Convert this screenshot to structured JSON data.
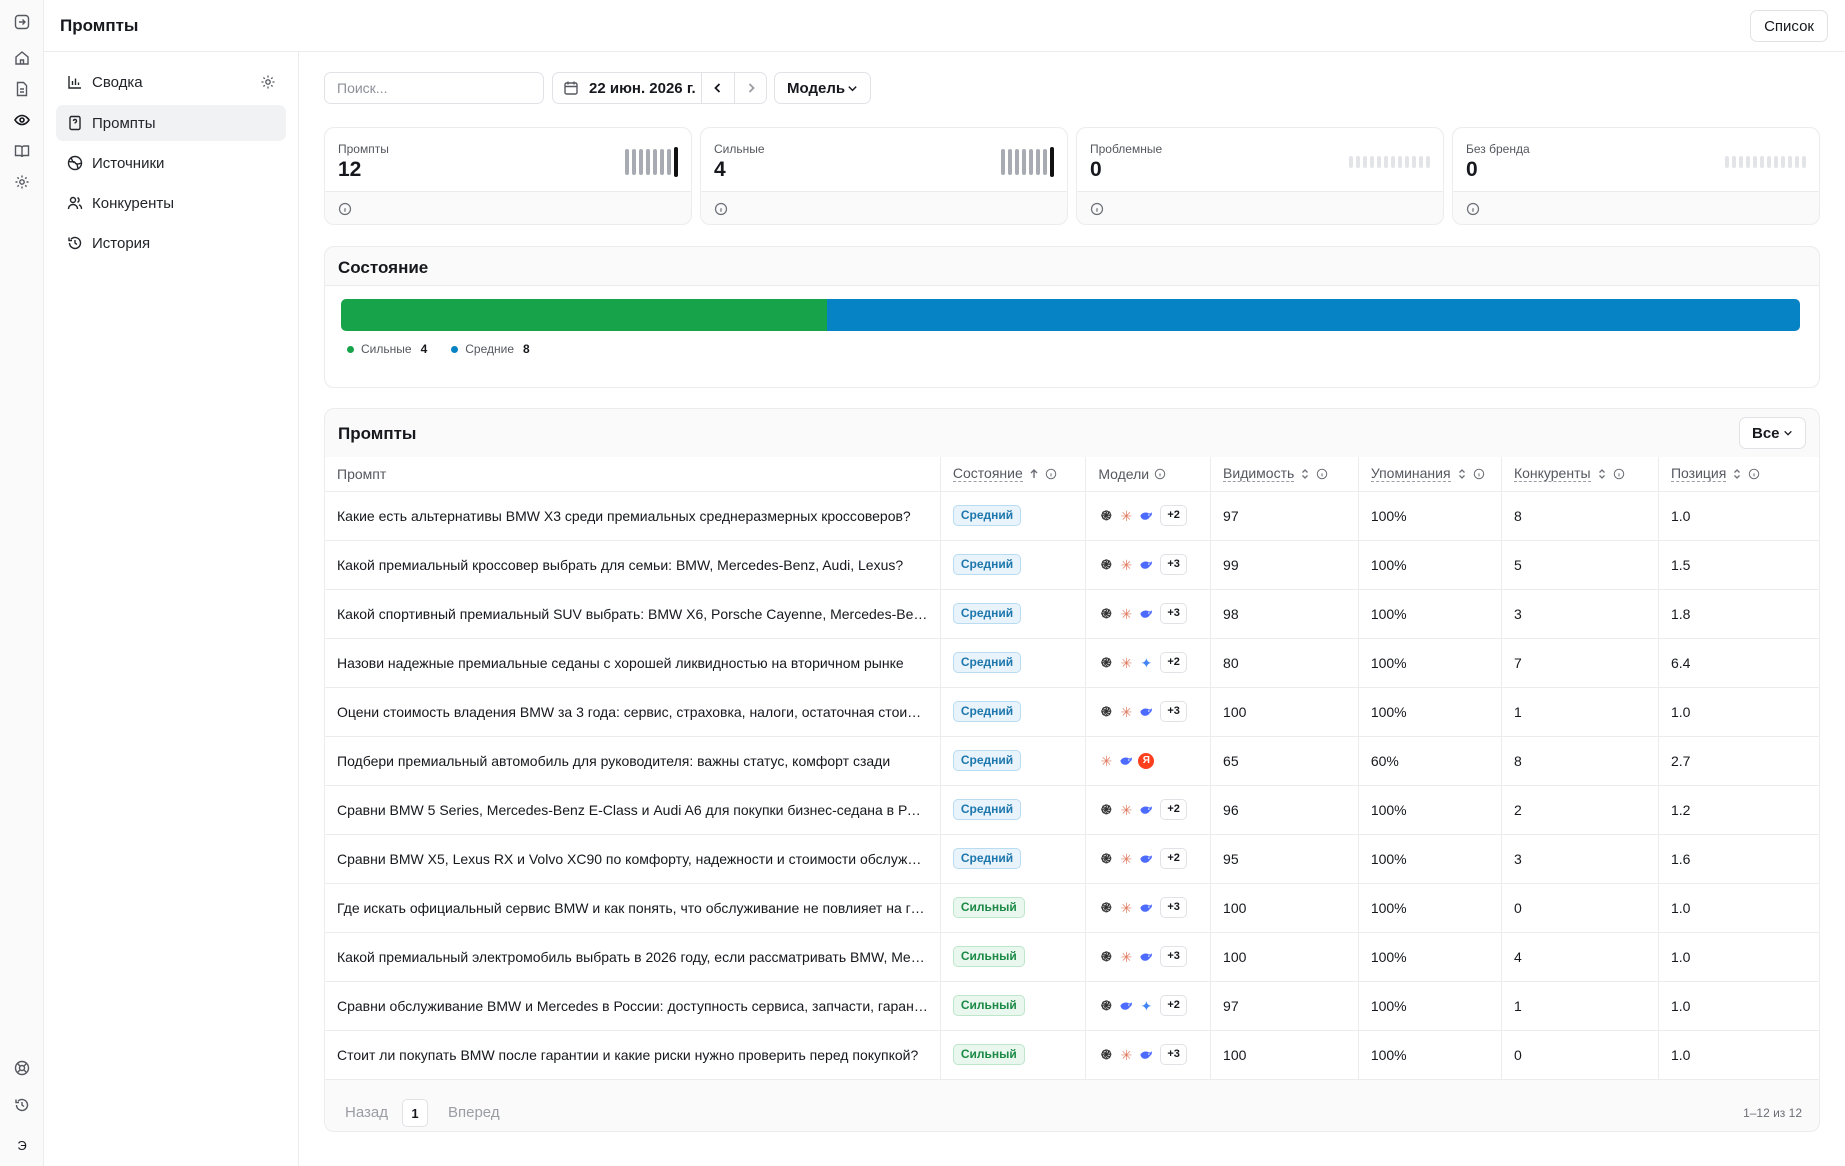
{
  "page": {
    "title": "Промпты",
    "list_button": "Список"
  },
  "rail": {
    "icons": [
      "sidebar-toggle-icon",
      "home-icon",
      "document-icon",
      "eye-icon",
      "book-icon",
      "gear-icon",
      "help-icon",
      "history-icon",
      "logo-icon"
    ],
    "logo_text": "Э"
  },
  "sidebar": {
    "items": [
      {
        "label": "Сводка",
        "icon": "bar-chart-icon",
        "active": false
      },
      {
        "label": "Промпты",
        "icon": "prompt-doc-icon",
        "active": true
      },
      {
        "label": "Источники",
        "icon": "globe-icon",
        "active": false
      },
      {
        "label": "Конкуренты",
        "icon": "users-icon",
        "active": false
      },
      {
        "label": "История",
        "icon": "history-icon",
        "active": false
      }
    ]
  },
  "filters": {
    "search_placeholder": "Поиск...",
    "date": "22 июн. 2026 г.",
    "model_label": "Модель"
  },
  "stats": [
    {
      "label": "Промпты",
      "value": "12",
      "bars": 8,
      "active_bars": 8
    },
    {
      "label": "Сильные",
      "value": "4",
      "bars": 8,
      "active_bars": 8
    },
    {
      "label": "Проблемные",
      "value": "0",
      "bars": 12,
      "active_bars": 0
    },
    {
      "label": "Без бренда",
      "value": "0",
      "bars": 12,
      "active_bars": 0
    }
  ],
  "state": {
    "title": "Состояние",
    "segments": [
      {
        "label": "Сильные",
        "count": "4",
        "value": 4,
        "color": "#16a34a"
      },
      {
        "label": "Средние",
        "count": "8",
        "value": 8,
        "color": "#0683c5"
      }
    ]
  },
  "prompts_table": {
    "title": "Промпты",
    "filter_label": "Все",
    "columns": [
      "Промпт",
      "Состояние",
      "Модели",
      "Видимость",
      "Упоминания",
      "Конкуренты",
      "Позиция"
    ],
    "rows": [
      {
        "prompt": "Какие есть альтернативы BMW X3 среди премиальных среднеразмерных кроссоверов?",
        "state": "Средний",
        "models": [
          "gpt",
          "claude",
          "deepseek"
        ],
        "more": "+2",
        "visibility": "97",
        "mentions": "100%",
        "competitors": "8",
        "position": "1.0"
      },
      {
        "prompt": "Какой премиальный кроссовер выбрать для семьи: BMW, Mercedes-Benz, Audi, Lexus?",
        "state": "Средний",
        "models": [
          "gpt",
          "claude",
          "deepseek"
        ],
        "more": "+3",
        "visibility": "99",
        "mentions": "100%",
        "competitors": "5",
        "position": "1.5"
      },
      {
        "prompt": "Какой спортивный премиальный SUV выбрать: BMW X6, Porsche Cayenne, Mercedes-Benz GLE?",
        "state": "Средний",
        "models": [
          "gpt",
          "claude",
          "deepseek"
        ],
        "more": "+3",
        "visibility": "98",
        "mentions": "100%",
        "competitors": "3",
        "position": "1.8"
      },
      {
        "prompt": "Назови надежные премиальные седаны с хорошей ликвидностью на вторичном рынке",
        "state": "Средний",
        "models": [
          "gpt",
          "claude",
          "gemini"
        ],
        "more": "+2",
        "visibility": "80",
        "mentions": "100%",
        "competitors": "7",
        "position": "6.4"
      },
      {
        "prompt": "Оцени стоимость владения BMW за 3 года: сервис, страховка, налоги, остаточная стоимость",
        "state": "Средний",
        "models": [
          "gpt",
          "claude",
          "deepseek"
        ],
        "more": "+3",
        "visibility": "100",
        "mentions": "100%",
        "competitors": "1",
        "position": "1.0"
      },
      {
        "prompt": "Подбери премиальный автомобиль для руководителя: важны статус, комфорт сзади",
        "state": "Средний",
        "models": [
          "claude",
          "deepseek",
          "yandex"
        ],
        "more": "",
        "visibility": "65",
        "mentions": "60%",
        "competitors": "8",
        "position": "2.7"
      },
      {
        "prompt": "Сравни BMW 5 Series, Mercedes-Benz E-Class и Audi A6 для покупки бизнес-седана в России",
        "state": "Средний",
        "models": [
          "gpt",
          "claude",
          "deepseek"
        ],
        "more": "+2",
        "visibility": "96",
        "mentions": "100%",
        "competitors": "2",
        "position": "1.2"
      },
      {
        "prompt": "Сравни BMW X5, Lexus RX и Volvo XC90 по комфорту, надежности и стоимости обслуживания",
        "state": "Средний",
        "models": [
          "gpt",
          "claude",
          "deepseek"
        ],
        "more": "+2",
        "visibility": "95",
        "mentions": "100%",
        "competitors": "3",
        "position": "1.6"
      },
      {
        "prompt": "Где искать официальный сервис BMW и как понять, что обслуживание не повлияет на гарантию?",
        "state": "Сильный",
        "models": [
          "gpt",
          "claude",
          "deepseek"
        ],
        "more": "+3",
        "visibility": "100",
        "mentions": "100%",
        "competitors": "0",
        "position": "1.0"
      },
      {
        "prompt": "Какой премиальный электромобиль выбрать в 2026 году, если рассматривать BMW, Mercedes и Audi?",
        "state": "Сильный",
        "models": [
          "gpt",
          "claude",
          "deepseek"
        ],
        "more": "+3",
        "visibility": "100",
        "mentions": "100%",
        "competitors": "4",
        "position": "1.0"
      },
      {
        "prompt": "Сравни обслуживание BMW и Mercedes в России: доступность сервиса, запчасти, гарантия",
        "state": "Сильный",
        "models": [
          "gpt",
          "deepseek",
          "gemini"
        ],
        "more": "+2",
        "visibility": "97",
        "mentions": "100%",
        "competitors": "1",
        "position": "1.0"
      },
      {
        "prompt": "Стоит ли покупать BMW после гарантии и какие риски нужно проверить перед покупкой?",
        "state": "Сильный",
        "models": [
          "gpt",
          "claude",
          "deepseek"
        ],
        "more": "+3",
        "visibility": "100",
        "mentions": "100%",
        "competitors": "0",
        "position": "1.0"
      }
    ]
  },
  "pagination": {
    "prev": "Назад",
    "page": "1",
    "next": "Вперед",
    "total": "1–12 из 12"
  },
  "colors": {
    "strong": "#16a34a",
    "medium": "#0683c5",
    "bar_dark": "#111111",
    "bar_light": "#a8abb2",
    "bar_empty": "#e3e4e7"
  }
}
